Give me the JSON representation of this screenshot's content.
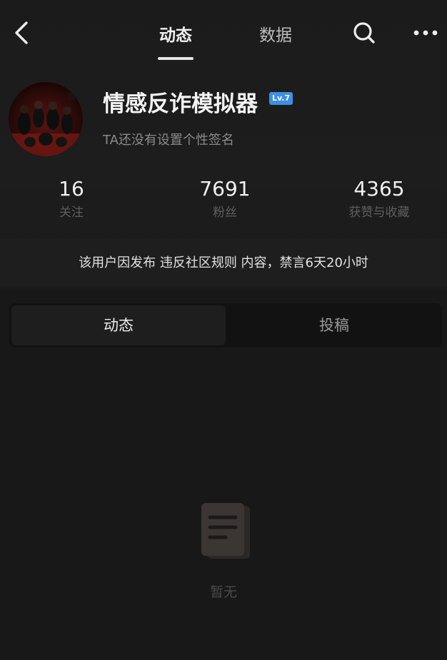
{
  "header": {
    "back_icon": "chevron-left-icon",
    "tabs": [
      {
        "label": "动态",
        "active": true
      },
      {
        "label": "数据",
        "active": false
      }
    ],
    "search_icon": "search-icon",
    "more_icon": "more-dots-icon"
  },
  "profile": {
    "name": "情感反诈模拟器",
    "level": "Lv.7",
    "signature": "TA还没有设置个性签名",
    "stats": [
      {
        "value": "16",
        "label": "关注"
      },
      {
        "value": "7691",
        "label": "粉丝"
      },
      {
        "value": "4365",
        "label": "获赞与收藏"
      }
    ]
  },
  "notice": {
    "text": "该用户因发布 违反社区规则 内容，禁言6天20小时"
  },
  "content_tabs": [
    {
      "label": "动态",
      "active": true
    },
    {
      "label": "投稿",
      "active": false
    }
  ],
  "empty_state": {
    "icon": "document-icon",
    "text": "暂无"
  },
  "colors": {
    "background": "#181818",
    "level_badge": "#3d8fe6"
  }
}
